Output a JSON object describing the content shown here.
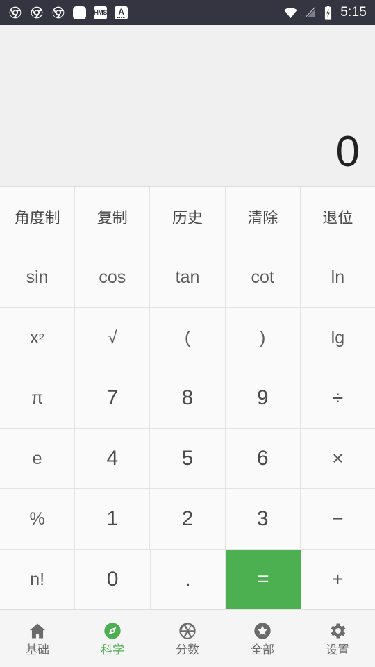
{
  "status_bar": {
    "background": "#343541",
    "left_icons": [
      {
        "name": "chrome-icon",
        "label": "Chrome"
      },
      {
        "name": "chrome-icon",
        "label": "Chrome"
      },
      {
        "name": "chrome-icon",
        "label": "Chrome"
      },
      {
        "name": "rounded-square-icon",
        "label": ""
      },
      {
        "name": "hms-icon",
        "label": "HMS"
      },
      {
        "name": "a-text-icon",
        "label": "A"
      }
    ],
    "right_icons": [
      {
        "name": "wifi-icon",
        "label": "wifi"
      },
      {
        "name": "signal-off-icon",
        "label": "no-signal"
      },
      {
        "name": "battery-charging-icon",
        "label": "charging"
      }
    ],
    "time": "5:15"
  },
  "display": {
    "value": "0",
    "background": "#f0f0f0"
  },
  "keypad": {
    "accent_color": "#4caf50",
    "rows": [
      [
        {
          "label": "角度制",
          "name": "key-degree-mode",
          "kind": "fn"
        },
        {
          "label": "复制",
          "name": "key-copy",
          "kind": "fn"
        },
        {
          "label": "历史",
          "name": "key-history",
          "kind": "fn"
        },
        {
          "label": "清除",
          "name": "key-clear",
          "kind": "fn"
        },
        {
          "label": "退位",
          "name": "key-backspace",
          "kind": "fn"
        }
      ],
      [
        {
          "label": "sin",
          "name": "key-sin",
          "kind": "sym"
        },
        {
          "label": "cos",
          "name": "key-cos",
          "kind": "sym"
        },
        {
          "label": "tan",
          "name": "key-tan",
          "kind": "sym"
        },
        {
          "label": "cot",
          "name": "key-cot",
          "kind": "sym"
        },
        {
          "label": "ln",
          "name": "key-ln",
          "kind": "sym"
        }
      ],
      [
        {
          "label": "x²",
          "name": "key-square",
          "kind": "sym"
        },
        {
          "label": "√",
          "name": "key-sqrt",
          "kind": "sym"
        },
        {
          "label": "(",
          "name": "key-paren-open",
          "kind": "sym"
        },
        {
          "label": ")",
          "name": "key-paren-close",
          "kind": "sym"
        },
        {
          "label": "lg",
          "name": "key-log10",
          "kind": "sym"
        }
      ],
      [
        {
          "label": "π",
          "name": "key-pi",
          "kind": "sym"
        },
        {
          "label": "7",
          "name": "key-7",
          "kind": "num"
        },
        {
          "label": "8",
          "name": "key-8",
          "kind": "num"
        },
        {
          "label": "9",
          "name": "key-9",
          "kind": "num"
        },
        {
          "label": "÷",
          "name": "key-divide",
          "kind": "op"
        }
      ],
      [
        {
          "label": "e",
          "name": "key-e",
          "kind": "sym"
        },
        {
          "label": "4",
          "name": "key-4",
          "kind": "num"
        },
        {
          "label": "5",
          "name": "key-5",
          "kind": "num"
        },
        {
          "label": "6",
          "name": "key-6",
          "kind": "num"
        },
        {
          "label": "×",
          "name": "key-multiply",
          "kind": "op"
        }
      ],
      [
        {
          "label": "%",
          "name": "key-percent",
          "kind": "sym"
        },
        {
          "label": "1",
          "name": "key-1",
          "kind": "num"
        },
        {
          "label": "2",
          "name": "key-2",
          "kind": "num"
        },
        {
          "label": "3",
          "name": "key-3",
          "kind": "num"
        },
        {
          "label": "−",
          "name": "key-subtract",
          "kind": "op"
        }
      ],
      [
        {
          "label": "n!",
          "name": "key-factorial",
          "kind": "sym"
        },
        {
          "label": "0",
          "name": "key-0",
          "kind": "num"
        },
        {
          "label": ".",
          "name": "key-decimal",
          "kind": "num"
        },
        {
          "label": "=",
          "name": "key-equals",
          "kind": "eq"
        },
        {
          "label": "+",
          "name": "key-add",
          "kind": "op"
        }
      ]
    ]
  },
  "bottom_nav": {
    "active_index": 1,
    "active_color": "#4caf50",
    "inactive_color": "#6b6b6b",
    "items": [
      {
        "label": "基础",
        "name": "nav-basic",
        "icon": "home-icon"
      },
      {
        "label": "科学",
        "name": "nav-scientific",
        "icon": "compass-icon"
      },
      {
        "label": "分数",
        "name": "nav-fraction",
        "icon": "aperture-icon"
      },
      {
        "label": "全部",
        "name": "nav-all",
        "icon": "star-circle-icon"
      },
      {
        "label": "设置",
        "name": "nav-settings",
        "icon": "gear-icon"
      }
    ]
  }
}
